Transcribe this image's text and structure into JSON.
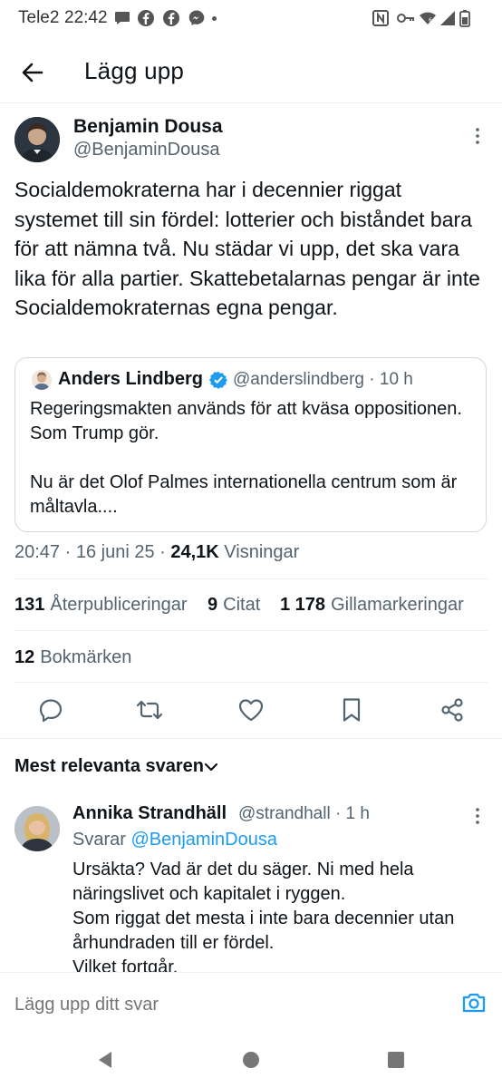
{
  "status_bar": {
    "carrier": "Tele2",
    "time": "22:42",
    "left_icons": [
      "chat-bubble-icon",
      "facebook-icon",
      "facebook-icon",
      "messenger-icon"
    ],
    "right_icons": [
      "nfc-icon",
      "key-icon",
      "wifi-icon",
      "signal-icon",
      "battery-icon"
    ]
  },
  "header": {
    "title": "Lägg upp"
  },
  "tweet": {
    "author_name": "Benjamin Dousa",
    "author_handle": "@BenjaminDousa",
    "text": "Socialdemokraterna har i decennier riggat systemet till sin fördel: lotterier och biståndet bara för att nämna två. Nu städar vi upp, det ska vara lika för alla partier. Skattebetalarnas pengar är inte Socialdemokraternas egna pengar.",
    "quote": {
      "name": "Anders Lindberg",
      "meta": "@anderslindberg · 10 h",
      "text": "Regeringsmakten används för att kväsa oppositionen. Som Trump gör.\n\nNu är det Olof Palmes internationella centrum som är måltavla...."
    },
    "timestamp": "20:47 · 16 juni 25 · ",
    "views_count": "24,1K",
    "views_label": " Visningar",
    "stats": {
      "reposts_count": "131",
      "reposts_label": "Återpubliceringar",
      "quotes_count": "9",
      "quotes_label": "Citat",
      "likes_count": "1 178",
      "likes_label": "Gillamarkeringar",
      "bookmarks_count": "12",
      "bookmarks_label": "Bokmärken"
    }
  },
  "replies": {
    "sort_label": "Mest relevanta svaren",
    "items": [
      {
        "name": "Annika Strandhäll",
        "meta": "@strandhall · 1 h",
        "replying_prefix": "Svarar ",
        "replying_to": "@BenjaminDousa",
        "text": "Ursäkta? Vad är det du säger. Ni med hela näringslivet och kapitalet i ryggen.\nSom riggat det mesta i inte bara decennier utan århundraden till er fördel.\nVilket fortgår."
      }
    ]
  },
  "composer": {
    "placeholder": "Lägg upp ditt svar"
  },
  "colors": {
    "accent": "#1d9bf0",
    "secondary_text": "#536471",
    "primary_text": "#0f1419"
  }
}
